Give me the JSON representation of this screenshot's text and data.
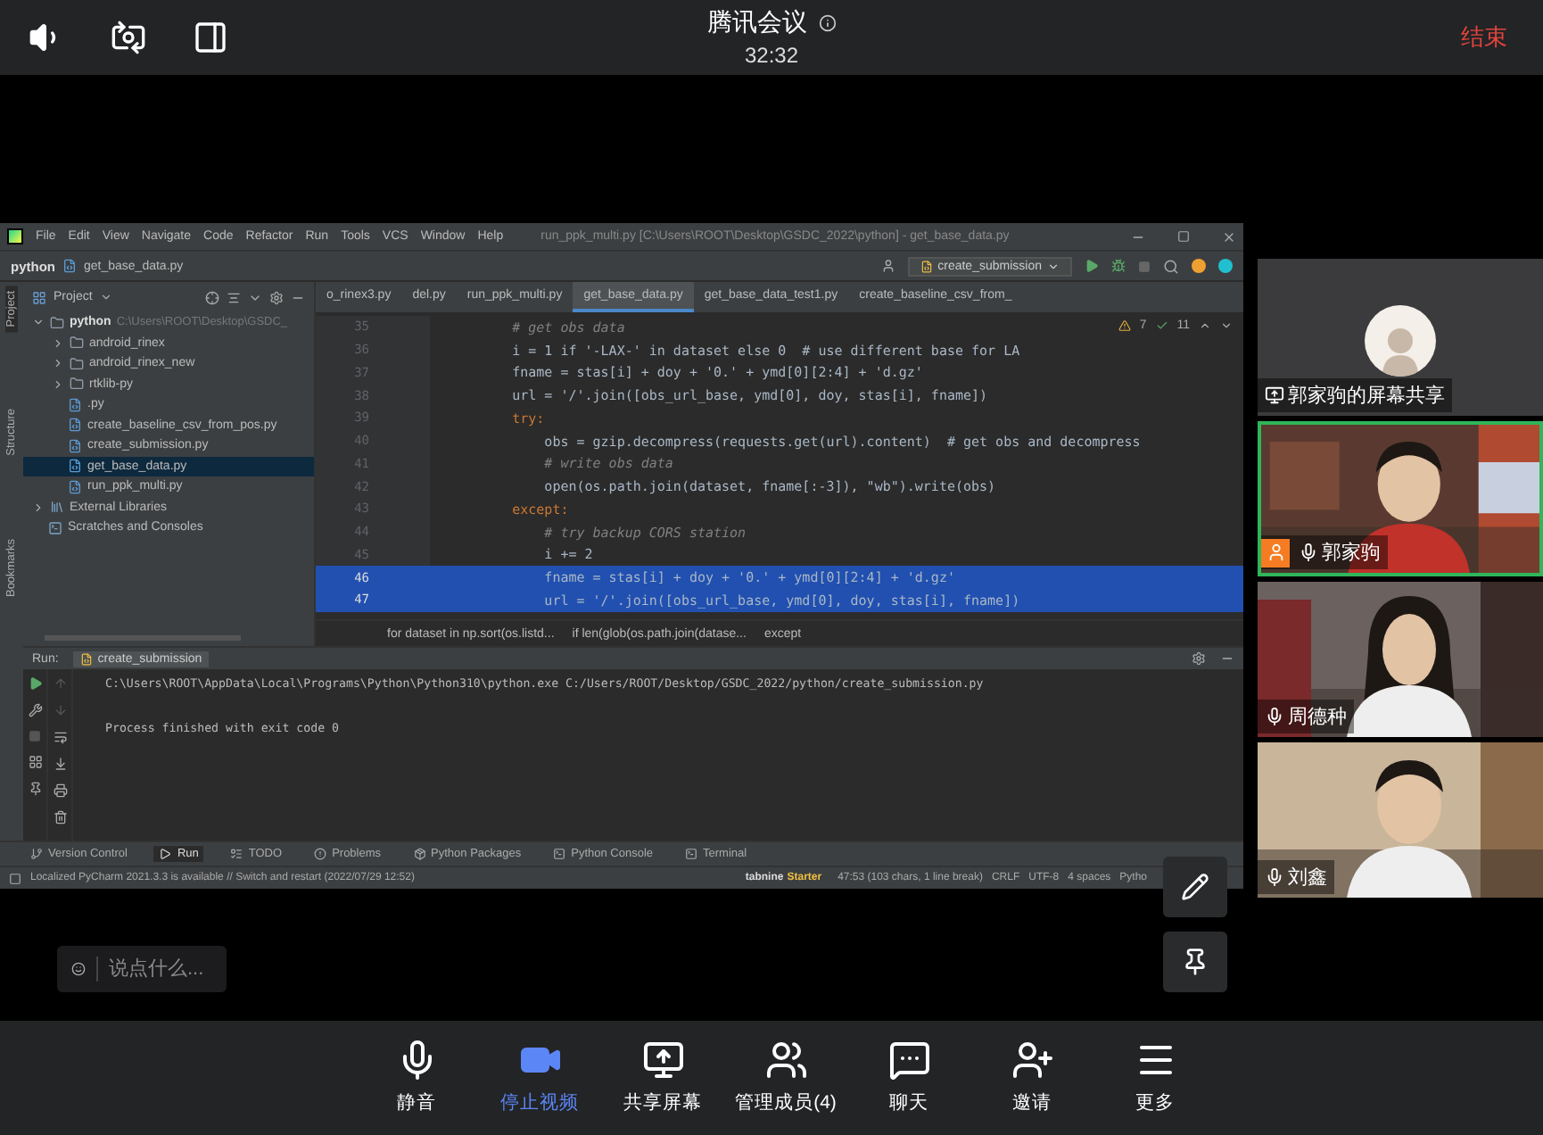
{
  "meeting": {
    "title": "腾讯会议",
    "elapsed": "32:32",
    "end_label": "结束"
  },
  "ide": {
    "window_title": "run_ppk_multi.py [C:\\Users\\ROOT\\Desktop\\GSDC_2022\\python] - get_base_data.py",
    "menu": [
      "File",
      "Edit",
      "View",
      "Navigate",
      "Code",
      "Refactor",
      "Run",
      "Tools",
      "VCS",
      "Window",
      "Help"
    ],
    "nav": {
      "project": "python",
      "file": "get_base_data.py",
      "run_config": "create_submission"
    },
    "side_tabs": [
      {
        "label": "Project",
        "selected": true
      },
      {
        "label": "Structure",
        "selected": false
      },
      {
        "label": "Bookmarks",
        "selected": false
      }
    ],
    "project_panel": {
      "title": "Project",
      "tree": [
        {
          "label": "python",
          "path": "C:\\Users\\ROOT\\Desktop\\GSDC_",
          "kind": "folder",
          "expanded": true,
          "selected": false,
          "children": [
            {
              "label": "android_rinex",
              "kind": "folder",
              "expanded": false,
              "selected": false
            },
            {
              "label": "android_rinex_new",
              "kind": "folder",
              "expanded": false,
              "selected": false
            },
            {
              "label": "rtklib-py",
              "kind": "folder",
              "expanded": false,
              "selected": false
            },
            {
              "label": ".py",
              "kind": "file",
              "selected": false
            },
            {
              "label": "create_baseline_csv_from_pos.py",
              "kind": "file",
              "selected": false
            },
            {
              "label": "create_submission.py",
              "kind": "file",
              "selected": false
            },
            {
              "label": "get_base_data.py",
              "kind": "file",
              "selected": true
            },
            {
              "label": "run_ppk_multi.py",
              "kind": "file",
              "selected": false
            }
          ]
        },
        {
          "label": "External Libraries",
          "kind": "library",
          "expanded": false,
          "selected": false
        },
        {
          "label": "Scratches and Consoles",
          "kind": "scratches",
          "selected": false
        }
      ]
    },
    "editor_tabs": [
      {
        "label": "o_rinex3.py",
        "selected": false
      },
      {
        "label": "del.py",
        "selected": false
      },
      {
        "label": "run_ppk_multi.py",
        "selected": false
      },
      {
        "label": "get_base_data.py",
        "selected": true
      },
      {
        "label": "get_base_data_test1.py",
        "selected": false
      },
      {
        "label": "create_baseline_csv_from_",
        "selected": false
      }
    ],
    "inspections": {
      "warnings": "7",
      "typos": "11"
    },
    "code": [
      {
        "number": "35",
        "text": "# get obs data",
        "kind": "comment",
        "selected": false
      },
      {
        "number": "36",
        "text": "i = 1 if '-LAX-' in dataset else 0  # use different base for LA",
        "kind": "code",
        "selected": false
      },
      {
        "number": "37",
        "text": "fname = stas[i] + doy + '0.' + ymd[0][2:4] + 'd.gz'",
        "kind": "code",
        "selected": false
      },
      {
        "number": "38",
        "text": "url = '/'.join([obs_url_base, ymd[0], doy, stas[i], fname])",
        "kind": "code",
        "selected": false
      },
      {
        "number": "39",
        "text": "try:",
        "kind": "keyword",
        "selected": false
      },
      {
        "number": "40",
        "text": "    obs = gzip.decompress(requests.get(url).content)  # get obs and decompress",
        "kind": "code",
        "selected": false
      },
      {
        "number": "41",
        "text": "    # write obs data",
        "kind": "comment",
        "selected": false
      },
      {
        "number": "42",
        "text": "    open(os.path.join(dataset, fname[:-3]), \"wb\").write(obs)",
        "kind": "code",
        "selected": false
      },
      {
        "number": "43",
        "text": "except:",
        "kind": "keyword",
        "selected": false
      },
      {
        "number": "44",
        "text": "    # try backup CORS station",
        "kind": "comment",
        "selected": false
      },
      {
        "number": "45",
        "text": "    i += 2",
        "kind": "code",
        "selected": false
      },
      {
        "number": "46",
        "text": "    fname = stas[i] + doy + '0.' + ymd[0][2:4] + 'd.gz'",
        "kind": "code",
        "selected": true
      },
      {
        "number": "47",
        "text": "    url = '/'.join([obs_url_base, ymd[0], doy, stas[i], fname])",
        "kind": "code",
        "selected": true
      }
    ],
    "breadcrumbs": [
      "for dataset in np.sort(os.listd...",
      "if len(glob(os.path.join(datase...",
      "except"
    ],
    "run_panel": {
      "label": "Run:",
      "config": "create_submission",
      "console": [
        "C:\\Users\\ROOT\\AppData\\Local\\Programs\\Python\\Python310\\python.exe C:/Users/ROOT/Desktop/GSDC_2022/python/create_submission.py",
        "Process finished with exit code 0"
      ]
    },
    "tool_tabs": [
      {
        "label": "Version Control",
        "selected": false
      },
      {
        "label": "Run",
        "selected": true
      },
      {
        "label": "TODO",
        "selected": false
      },
      {
        "label": "Problems",
        "selected": false
      },
      {
        "label": "Python Packages",
        "selected": false
      },
      {
        "label": "Python Console",
        "selected": false
      },
      {
        "label": "Terminal",
        "selected": false
      }
    ],
    "status": {
      "message": "Localized PyCharm 2021.3.3 is available // Switch and restart (2022/07/29 12:52)",
      "plugin": "tabnine",
      "plugin_tier": "Starter",
      "items": [
        "47:53 (103 chars, 1 line break)",
        "CRLF",
        "UTF-8",
        "4 spaces",
        "Pytho"
      ]
    }
  },
  "participants": [
    {
      "kind": "screen_share",
      "name": "郭家驹的屏幕共享",
      "selected": false,
      "host": false
    },
    {
      "kind": "video",
      "name": "郭家驹",
      "selected": true,
      "host": true
    },
    {
      "kind": "video",
      "name": "周德种",
      "selected": false,
      "host": false
    },
    {
      "kind": "video",
      "name": "刘鑫",
      "selected": false,
      "host": false
    }
  ],
  "chat": {
    "placeholder": "说点什么..."
  },
  "toolbar": [
    {
      "label": "静音",
      "kind": "mic",
      "active": false
    },
    {
      "label": "停止视频",
      "kind": "video",
      "active": true
    },
    {
      "label": "共享屏幕",
      "kind": "share",
      "active": false
    },
    {
      "label": "管理成员(4)",
      "kind": "members",
      "active": false
    },
    {
      "label": "聊天",
      "kind": "chat",
      "active": false
    },
    {
      "label": "邀请",
      "kind": "invite",
      "active": false
    },
    {
      "label": "更多",
      "kind": "more",
      "active": false
    }
  ]
}
